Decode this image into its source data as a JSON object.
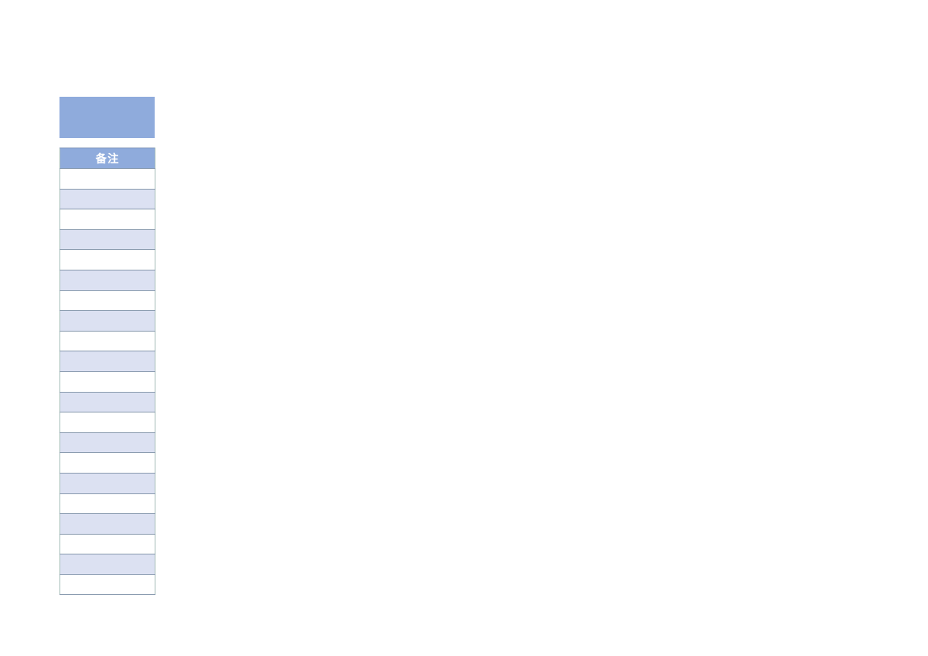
{
  "document": {
    "background_color": "#ffffff",
    "title_block": {
      "text": "",
      "fill_color": "#8fabdc"
    }
  },
  "table": {
    "name": "notes-table",
    "header_fill_color": "#8fabdc",
    "header_text_color": "#ffffff",
    "stripe_color": "#dce1f2",
    "base_color": "#ffffff",
    "border_color": "#8b9cb0",
    "columns": [
      {
        "key": "notes",
        "label": "备注"
      }
    ],
    "rows": [
      {
        "notes": ""
      },
      {
        "notes": ""
      },
      {
        "notes": ""
      },
      {
        "notes": ""
      },
      {
        "notes": ""
      },
      {
        "notes": ""
      },
      {
        "notes": ""
      },
      {
        "notes": ""
      },
      {
        "notes": ""
      },
      {
        "notes": ""
      },
      {
        "notes": ""
      },
      {
        "notes": ""
      },
      {
        "notes": ""
      },
      {
        "notes": ""
      },
      {
        "notes": ""
      },
      {
        "notes": ""
      },
      {
        "notes": ""
      },
      {
        "notes": ""
      },
      {
        "notes": ""
      },
      {
        "notes": ""
      },
      {
        "notes": ""
      }
    ]
  }
}
